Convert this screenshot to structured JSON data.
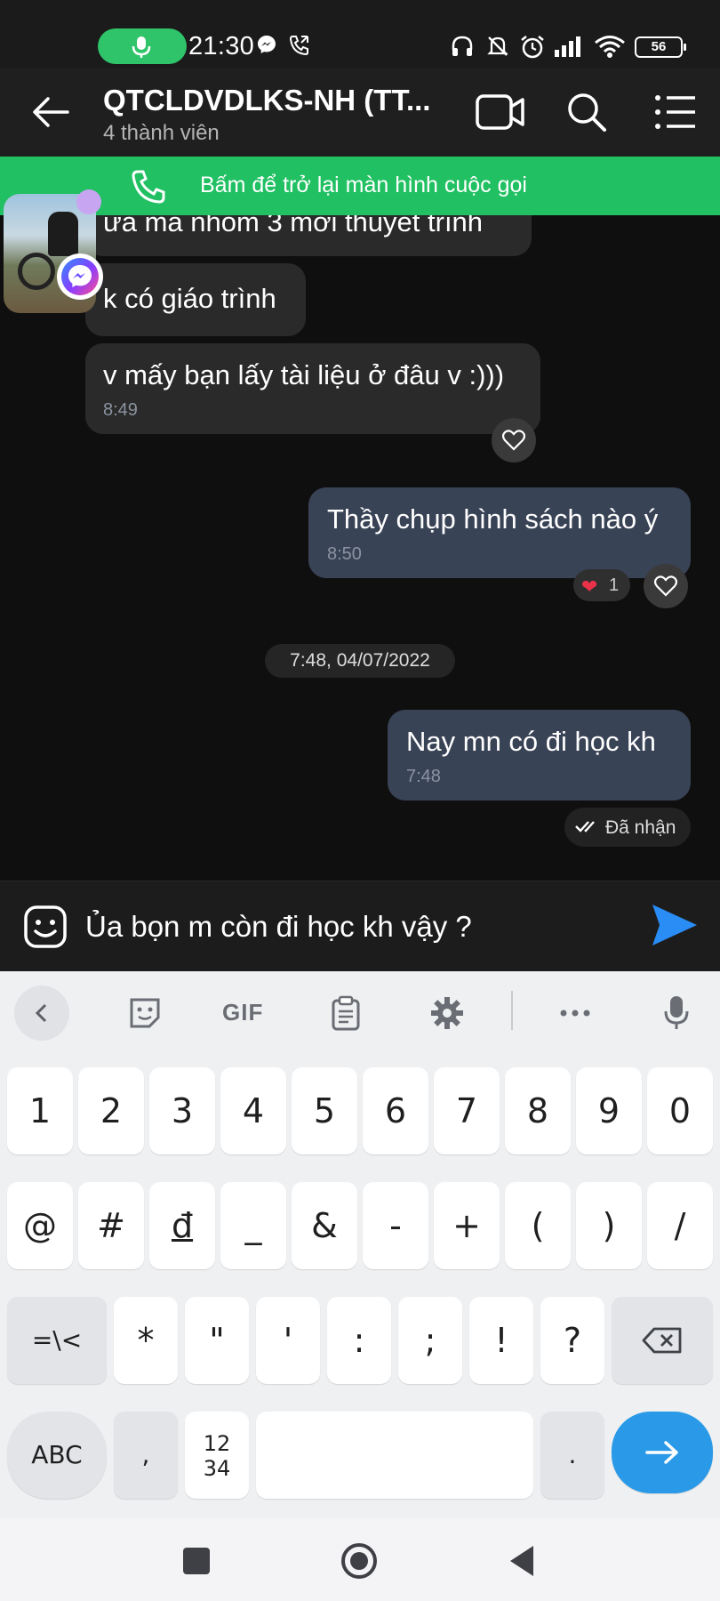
{
  "status_bar": {
    "time": "21:30",
    "battery": "56",
    "icons": [
      "mic-icon",
      "messenger-icon",
      "call-icon",
      "headphones-icon",
      "mute-bell-icon",
      "alarm-icon",
      "signal-icon",
      "wifi-icon",
      "battery-icon"
    ],
    "mic_pill_color": "#2fc36a"
  },
  "header": {
    "title": "QTCLDVDLKS-NH (TT...",
    "subtitle": "4 thành viên",
    "icons": [
      "back-arrow-icon",
      "video-call-icon",
      "search-icon",
      "menu-icon"
    ]
  },
  "call_banner": {
    "text": "Bấm để trở lại màn hình cuộc gọi",
    "color": "#21c062"
  },
  "chat": {
    "messages": [
      {
        "side": "incoming",
        "text": "ừa mà nhóm 3 mới thuyết trình"
      },
      {
        "side": "incoming",
        "text": "k có giáo trình"
      },
      {
        "side": "incoming",
        "text": "v mấy bạn lấy tài liệu ở đâu v :)))",
        "time": "8:49"
      },
      {
        "side": "outgoing",
        "text": "Thầy chụp hình sách nào ý",
        "time": "8:50",
        "reaction_count": "1"
      },
      {
        "side": "outgoing",
        "text": "Nay mn có đi học kh",
        "time": "7:48"
      }
    ],
    "date_separator": "7:48, 04/07/2022",
    "delivery_status": "Đã nhận"
  },
  "composer": {
    "text": "Ủa bọn m còn đi học kh vậy ?",
    "send_color": "#2a8cf5"
  },
  "keyboard": {
    "toolbar_gif": "GIF",
    "row1": [
      "1",
      "2",
      "3",
      "4",
      "5",
      "6",
      "7",
      "8",
      "9",
      "0"
    ],
    "row2": [
      "@",
      "#",
      "đ",
      "_",
      "&",
      "-",
      "+",
      "(",
      ")",
      "/"
    ],
    "row3": [
      "=\\<",
      "*",
      "\"",
      "'",
      ":",
      ";",
      "!",
      "?"
    ],
    "row4": {
      "abc": "ABC",
      "comma": ",",
      "num_top": "12",
      "num_bottom": "34",
      "period": "."
    },
    "enter_color": "#2a9ae8"
  }
}
